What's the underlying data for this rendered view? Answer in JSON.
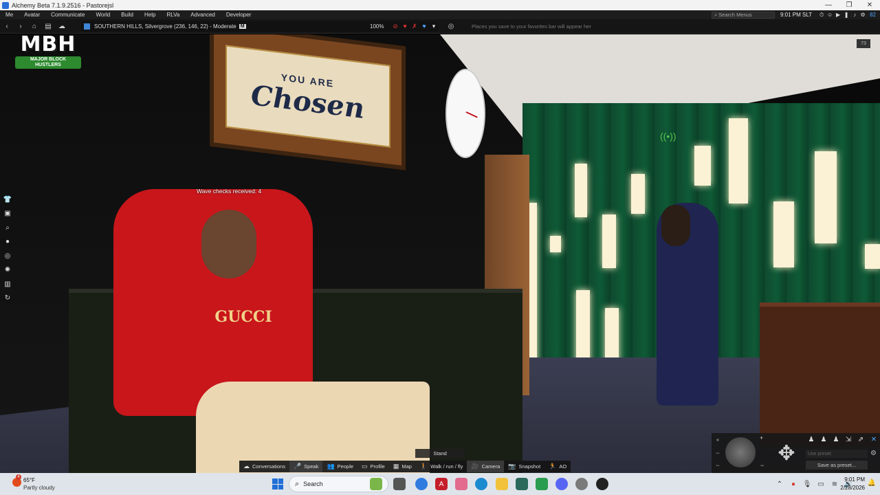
{
  "window": {
    "title": "Alchemy Beta 7.1.9.2516 - Pastorejsl",
    "controls": [
      "—",
      "❐",
      "✕"
    ]
  },
  "menubar": {
    "items": [
      "Me",
      "Avatar",
      "Communicate",
      "World",
      "Build",
      "Help",
      "RLVa",
      "Advanced",
      "Developer"
    ],
    "search_placeholder": "Search Menus",
    "time": "9:01 PM SLT",
    "counter": "82"
  },
  "navbar": {
    "location": "SOUTHERN HILLS, Silvergrove (236, 146, 22) - Moderate",
    "maturity_badge": "M",
    "zoom": "100%",
    "favorites_hint": "Places you save to your favorites bar will appear her"
  },
  "scene": {
    "overlay_text": "Wave checks received: 4",
    "corner_badge": "73",
    "sign_small": "YOU ARE",
    "sign_big": "Chosen",
    "shirt_brand": "GUCCI"
  },
  "logo": {
    "main": "MBH",
    "sub": "MAJOR BLOCK HUSTLERS"
  },
  "bottom_toolbar": {
    "stand": "Stand",
    "buttons": [
      {
        "label": "Conversations",
        "icon": "chat-icon"
      },
      {
        "label": "Speak",
        "icon": "mic-icon"
      },
      {
        "label": "People",
        "icon": "people-icon"
      },
      {
        "label": "Profile",
        "icon": "profile-icon"
      },
      {
        "label": "Map",
        "icon": "map-icon"
      },
      {
        "label": "Walk / run / fly",
        "icon": "walk-icon"
      },
      {
        "label": "Camera",
        "icon": "camera-icon"
      },
      {
        "label": "Snapshot",
        "icon": "snapshot-icon"
      },
      {
        "label": "AO",
        "icon": "ao-icon"
      }
    ]
  },
  "camera_panel": {
    "preset_placeholder": "Use preset",
    "save_preset": "Save as preset..."
  },
  "taskbar": {
    "weather_temp": "65°F",
    "weather_desc": "Partly cloudy",
    "weather_badge": "4",
    "search_placeholder": "Search",
    "time": "9:01 PM",
    "date": "2/28/2026"
  },
  "colors": {
    "accent_blue": "#4ea3ff",
    "alert_red": "#d23a2a",
    "green_wall": "#0f5a36",
    "shirt_red": "#c8161b"
  }
}
